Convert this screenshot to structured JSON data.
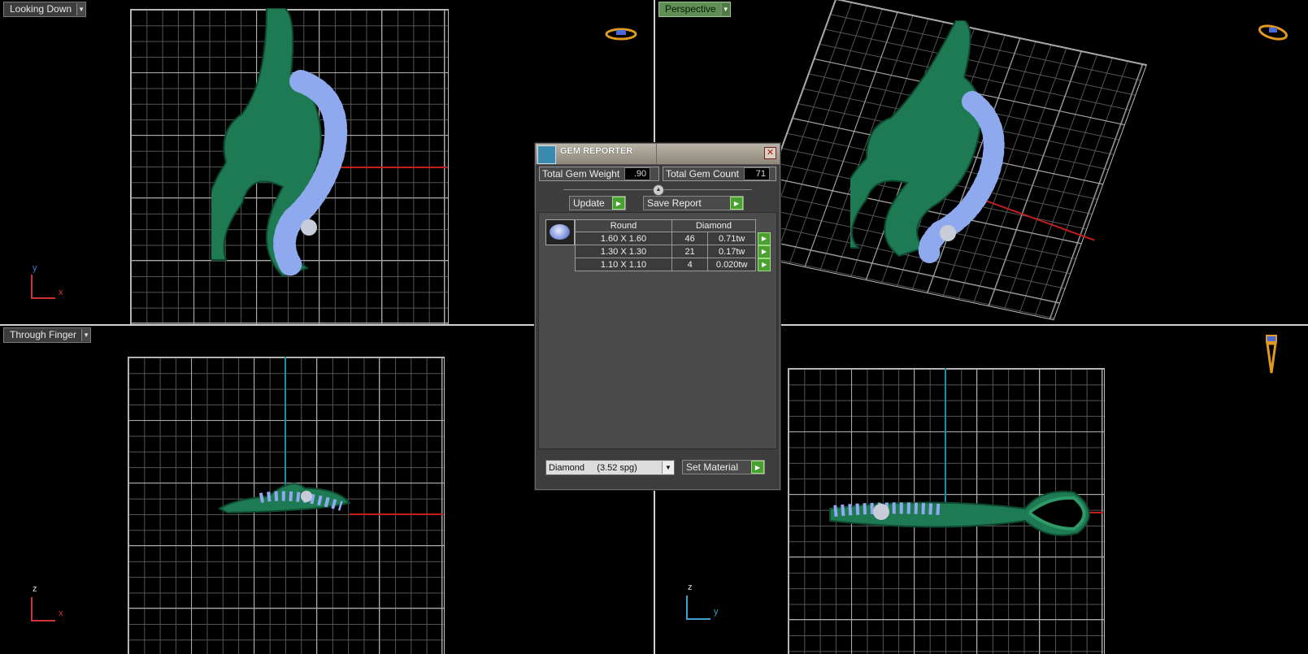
{
  "viewports": {
    "top_left": {
      "label": "Looking Down",
      "axes": {
        "v": "y",
        "h": "x"
      }
    },
    "top_right": {
      "label": "Perspective"
    },
    "bottom_left": {
      "label": "Through Finger",
      "axes": {
        "v": "z",
        "h": "x"
      }
    },
    "bottom_right": {
      "label": "",
      "axes": {
        "v": "z",
        "h": "y"
      }
    }
  },
  "gem_reporter": {
    "title": "GEM REPORTER",
    "total_gem_weight_label": "Total Gem Weight",
    "total_gem_weight": ".90",
    "total_gem_count_label": "Total Gem Count",
    "total_gem_count": "71",
    "update_label": "Update",
    "save_report_label": "Save Report",
    "table": {
      "header_shape": "Round",
      "header_material": "Diamond",
      "rows": [
        {
          "size": "1.60 X 1.60",
          "count": "46",
          "weight": "0.71tw"
        },
        {
          "size": "1.30 X 1.30",
          "count": "21",
          "weight": "0.17tw"
        },
        {
          "size": "1.10 X 1.10",
          "count": "4",
          "weight": "0.020tw"
        }
      ]
    },
    "material_select": "Diamond     (3.52 spg)",
    "set_material_label": "Set Material"
  },
  "colors": {
    "accent_green": "#4aa132",
    "model": "#1d7a52",
    "gem": "#8fa9ee",
    "axis_red": "#c21e1e",
    "axis_blue": "#1b8fa8"
  }
}
